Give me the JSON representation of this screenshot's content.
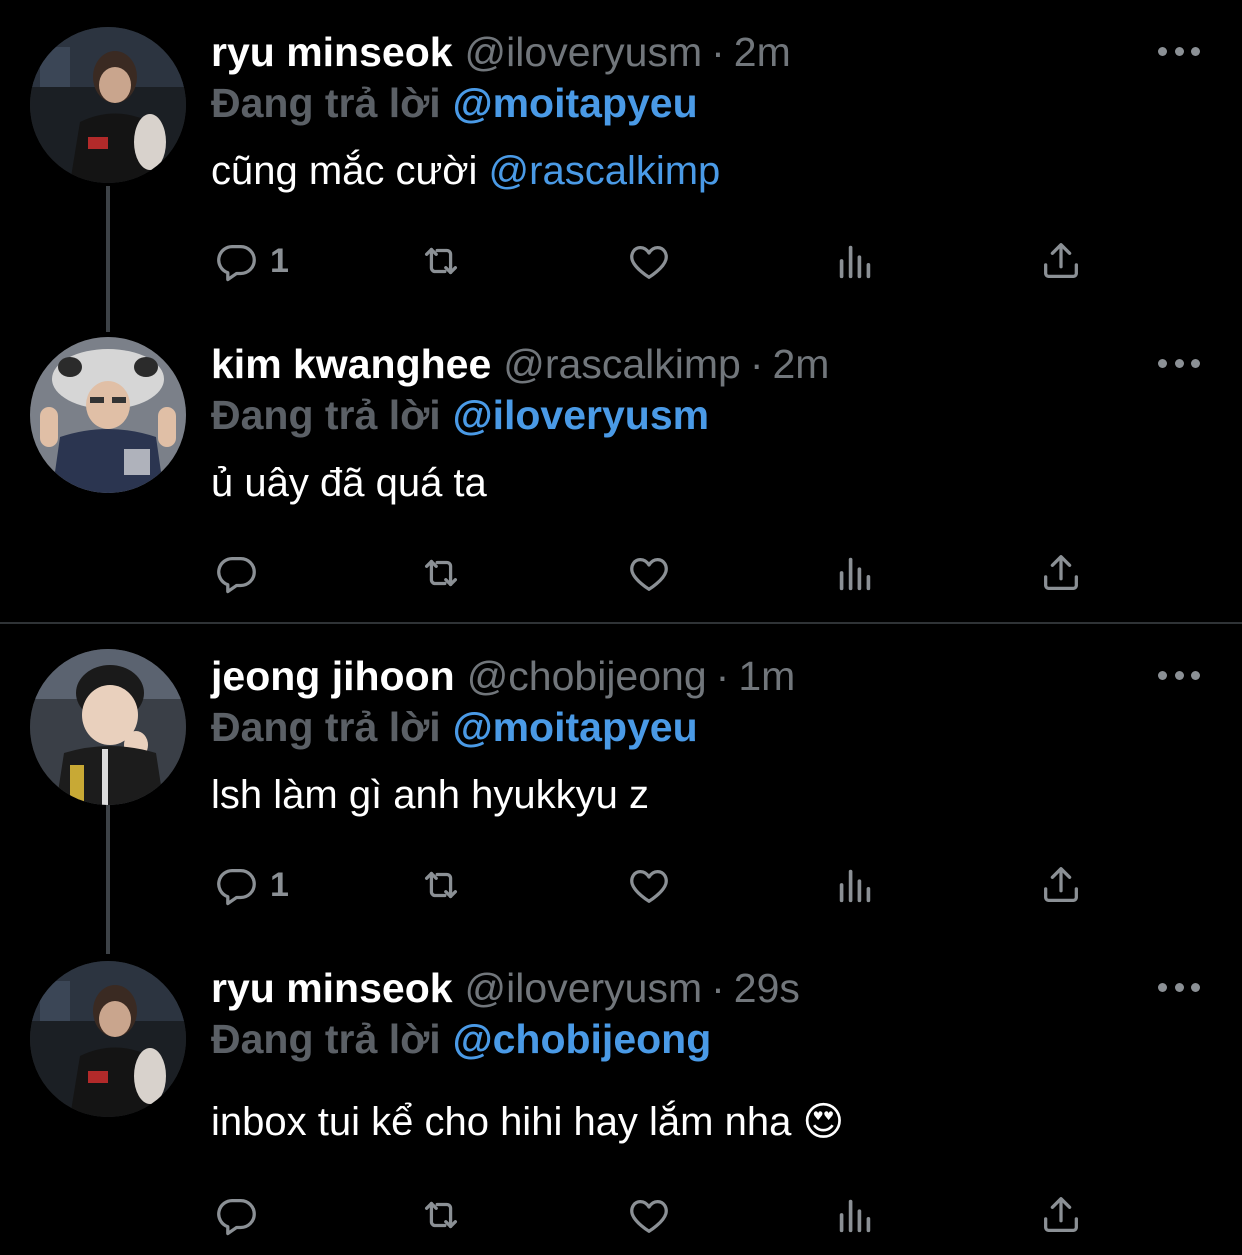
{
  "colors": {
    "background": "#000000",
    "name": "#ffffff",
    "muted": "#71767b",
    "mention": "#4a9ae6",
    "thread_line": "#3d4247"
  },
  "tweets": [
    {
      "name": "ryu minseok",
      "handle": "@iloveryusm",
      "separator": "·",
      "time": "2m",
      "replying_label": "Đang trả lời",
      "replying_to": "@moitapyeu",
      "text": "cũng mắc cười ",
      "text_mention": "@rascalkimp",
      "reply_count": "1",
      "avatar": "avatar-ryu-minseok"
    },
    {
      "name": "kim kwanghee",
      "handle": "@rascalkimp",
      "separator": "·",
      "time": "2m",
      "replying_label": "Đang trả lời",
      "replying_to": "@iloveryusm",
      "text": "ủ uây đã quá ta",
      "reply_count": "",
      "avatar": "avatar-kim-kwanghee"
    },
    {
      "name": "jeong jihoon",
      "handle": "@chobijeong",
      "separator": "·",
      "time": "1m",
      "replying_label": "Đang trả lời",
      "replying_to": "@moitapyeu",
      "text": "lsh làm gì anh hyukkyu z",
      "reply_count": "1",
      "avatar": "avatar-jeong-jihoon"
    },
    {
      "name": "ryu minseok",
      "handle": "@iloveryusm",
      "separator": "·",
      "time": "29s",
      "replying_label": "Đang trả lời",
      "replying_to": "@chobijeong",
      "text": "inbox tui kể cho hihi hay lắm nha 😍",
      "reply_count": "",
      "avatar": "avatar-ryu-minseok"
    }
  ],
  "icons": [
    "reply-icon",
    "retweet-icon",
    "like-icon",
    "views-icon",
    "share-icon",
    "more-icon"
  ]
}
